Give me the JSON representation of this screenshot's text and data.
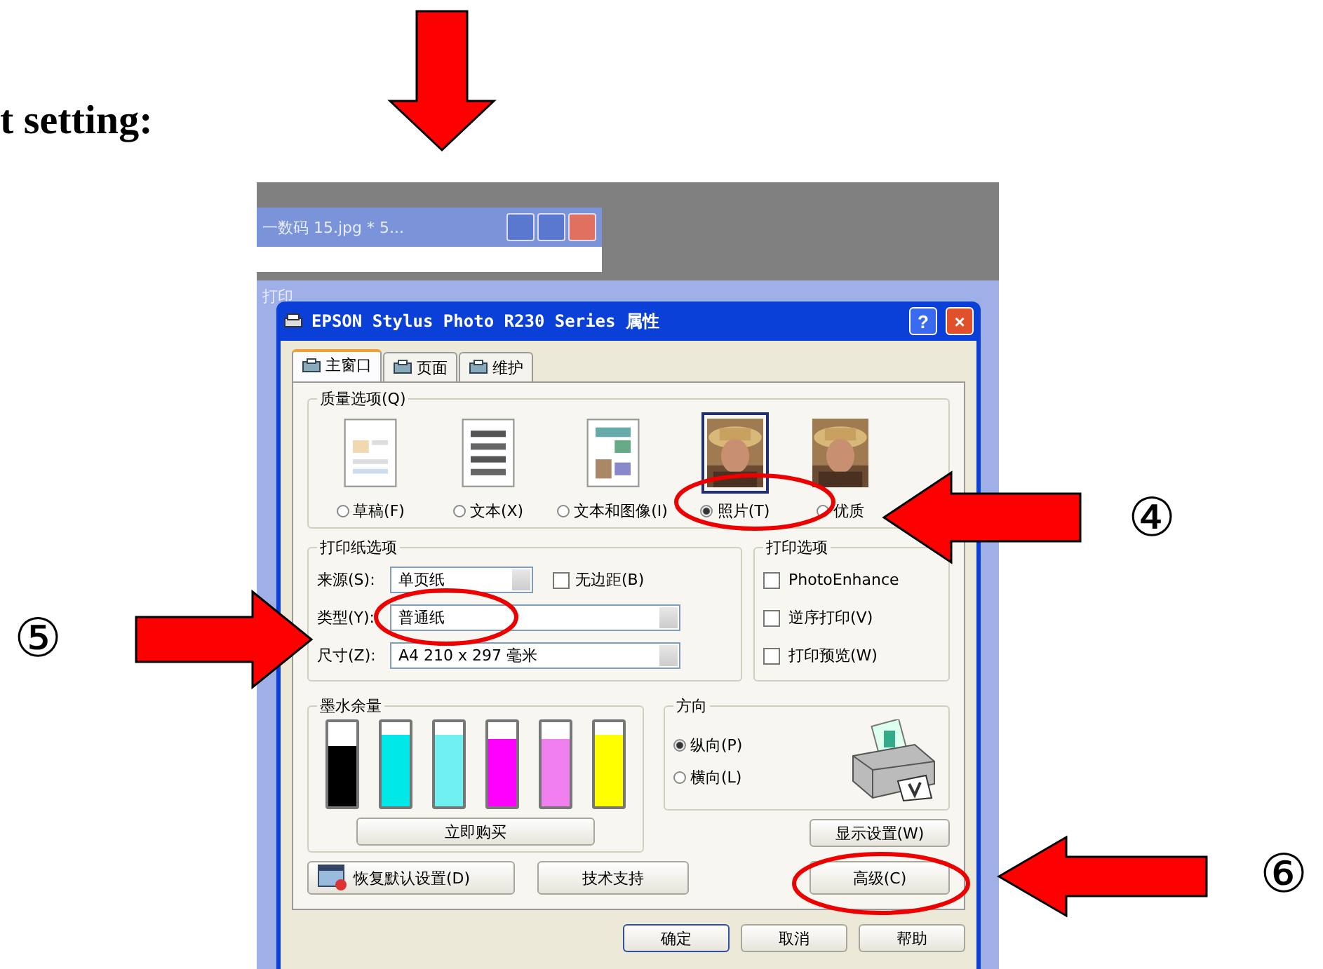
{
  "heading": "t setting:",
  "markers": [
    {
      "label": "④"
    },
    {
      "label": "⑤"
    },
    {
      "label": "⑥"
    }
  ],
  "background_window": {
    "title": "一数码 15.jpg * 5..."
  },
  "behind_window": {
    "title": "打印"
  },
  "dialog": {
    "title": "EPSON Stylus Photo R230 Series 属性",
    "tabs": [
      {
        "label": "主窗口",
        "selected": true
      },
      {
        "label": "页面",
        "selected": false
      },
      {
        "label": "维护",
        "selected": false
      }
    ],
    "quality": {
      "title": "质量选项(Q)",
      "options": [
        {
          "label": "草稿(F)",
          "kind": "draft",
          "selected": false
        },
        {
          "label": "文本(X)",
          "kind": "text",
          "selected": false
        },
        {
          "label": "文本和图像(I)",
          "kind": "mixed",
          "selected": false
        },
        {
          "label": "照片(T)",
          "selected": true
        },
        {
          "label": "优质",
          "selected": false
        }
      ]
    },
    "paper": {
      "title": "打印纸选项",
      "source": {
        "label": "来源(S):",
        "value": "单页纸"
      },
      "borderless": {
        "label": "无边距(B)",
        "checked": false
      },
      "type": {
        "label": "类型(Y):",
        "value": "普通纸"
      },
      "size": {
        "label": "尺寸(Z):",
        "value": "A4 210 x 297 毫米"
      }
    },
    "print_options": {
      "title": "打印选项",
      "items": [
        {
          "label": "PhotoEnhance",
          "checked": false
        },
        {
          "label": "逆序打印(V)",
          "checked": false
        },
        {
          "label": "打印预览(W)",
          "checked": false
        }
      ]
    },
    "ink": {
      "title": "墨水余量",
      "cartridges": [
        {
          "color": "#000000",
          "level": 0.72
        },
        {
          "color": "#00e8e8",
          "level": 0.85
        },
        {
          "color": "#70f0f0",
          "level": 0.85
        },
        {
          "color": "#ff00ff",
          "level": 0.8
        },
        {
          "color": "#f080f0",
          "level": 0.8
        },
        {
          "color": "#ffff00",
          "level": 0.85
        }
      ],
      "buy_button": "立即购买"
    },
    "orientation": {
      "title": "方向",
      "options": [
        {
          "label": "纵向(P)",
          "selected": true
        },
        {
          "label": "横向(L)",
          "selected": false
        }
      ]
    },
    "help_glyph": "?",
    "close_glyph": "×",
    "show_settings_button": "显示设置(W)",
    "restore_button": "恢复默认设置(D)",
    "support_button": "技术支持",
    "advanced_button": "高级(C)",
    "footer_buttons": [
      "确定",
      "取消",
      "帮助"
    ]
  }
}
